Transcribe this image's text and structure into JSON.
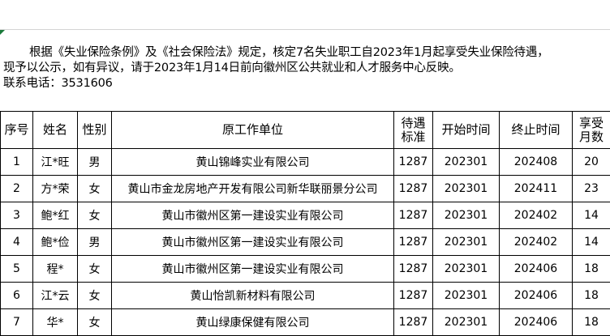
{
  "notice": {
    "line1": "根据《失业保险条例》及《社会保险法》规定，核定7名失业职工自2023年1月起享受失业保险待遇，",
    "line2": "现予以公示，如有异议，请于2023年1月14日前向徽州区公共就业和人才服务中心反映。",
    "line3": "联系电话：3531606"
  },
  "table": {
    "headers": {
      "seq": "序号",
      "name": "姓名",
      "sex": "性别",
      "unit": "原工作单位",
      "std_1": "待遇",
      "std_2": "标准",
      "start": "开始时间",
      "end": "终止时间",
      "months_1": "享受",
      "months_2": "月数"
    },
    "rows": [
      {
        "seq": "1",
        "name": "江*旺",
        "sex": "男",
        "unit": "黄山锦峰实业有限公司",
        "std": "1287",
        "start": "202301",
        "end": "202408",
        "months": "20"
      },
      {
        "seq": "2",
        "name": "方*荣",
        "sex": "女",
        "unit": "黄山市金龙房地产开发有限公司新华联丽景分公司",
        "std": "1287",
        "start": "202301",
        "end": "202411",
        "months": "23"
      },
      {
        "seq": "3",
        "name": "鲍*红",
        "sex": "女",
        "unit": "黄山市徽州区第一建设实业有限公司",
        "std": "1287",
        "start": "202301",
        "end": "202402",
        "months": "14"
      },
      {
        "seq": "4",
        "name": "鲍*俭",
        "sex": "男",
        "unit": "黄山市徽州区第一建设实业有限公司",
        "std": "1287",
        "start": "202301",
        "end": "202402",
        "months": "14"
      },
      {
        "seq": "5",
        "name": "程*",
        "sex": "女",
        "unit": "黄山市徽州区第一建设实业有限公司",
        "std": "1287",
        "start": "202301",
        "end": "202406",
        "months": "18"
      },
      {
        "seq": "6",
        "name": "江*云",
        "sex": "女",
        "unit": "黄山怡凯新材料有限公司",
        "std": "1287",
        "start": "202301",
        "end": "202406",
        "months": "18"
      },
      {
        "seq": "7",
        "name": "华*",
        "sex": "女",
        "unit": "黄山绿康保健有限公司",
        "std": "1287",
        "start": "202301",
        "end": "202406",
        "months": "18"
      }
    ]
  }
}
